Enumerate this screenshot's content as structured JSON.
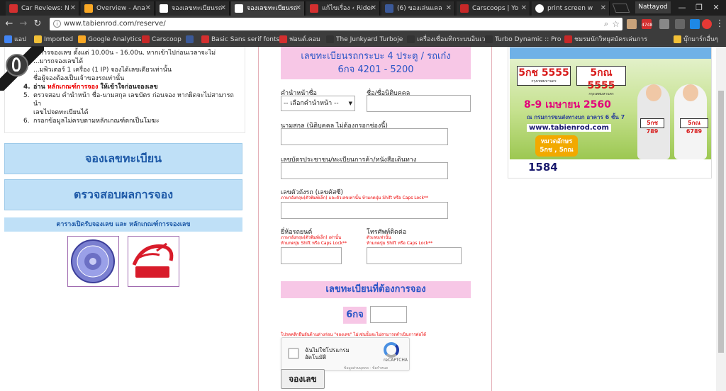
{
  "browser": {
    "tabs": [
      {
        "title": "Car Reviews: N",
        "favicon_color": "#d32f2f"
      },
      {
        "title": "Overview - Ana",
        "favicon_color": "#f9a825"
      },
      {
        "title": "จองเลขทะเบียนรถ",
        "favicon_color": "#ffffff"
      },
      {
        "title": "จองเลขทะเบียนรถ",
        "favicon_color": "#ffffff"
      },
      {
        "title": "แก้ไขเรื่อง ‹ Rider",
        "favicon_color": "#d32f2f"
      },
      {
        "title": "(6) ของเล่นแคล",
        "favicon_color": "#3b5998"
      },
      {
        "title": "Carscoops | Yo",
        "favicon_color": "#c62828"
      },
      {
        "title": "print screen w",
        "favicon_color": "#ffffff"
      }
    ],
    "user_name": "Nattayod",
    "url": "www.tabienrod.com/reserve/",
    "bookmarks": [
      {
        "label": "แอป",
        "color": "#4285f4"
      },
      {
        "label": "Imported",
        "color": "#f2c037"
      },
      {
        "label": "Google Analytics",
        "color": "#f9a825"
      },
      {
        "label": "Carscoop",
        "color": "#c62828"
      },
      {
        "label": "",
        "color": "#3b5998"
      },
      {
        "label": "Basic Sans serif fonts",
        "color": "#d32f2f"
      },
      {
        "label": "ฟอนต์.คอม",
        "color": "#d32f2f"
      },
      {
        "label": "The Junkyard Turboje",
        "color": "#333333"
      },
      {
        "label": "เครื่องเชื่อมทิกระบบอินเวอ",
        "color": "#333333"
      },
      {
        "label": "Turbo Dynamic :: Pro",
        "color": "#333333"
      },
      {
        "label": "ชมรมนักวิทยุสมัครเล่นการ",
        "color": "#c62828"
      },
      {
        "label": "บุ๊กมาร์กอื่นๆ",
        "color": "#f2c037"
      }
    ],
    "ext_badge": "4748"
  },
  "left": {
    "rules": [
      {
        "n": "",
        "text": "...การจองเลข ตั้งแต่ 10.00น - 16.00น. หากเข้าไปก่อนเวลาจะไม่"
      },
      {
        "n": "",
        "text": "...มารถจองเลขได้"
      },
      {
        "n": "",
        "text": "...มพิวเตอร์ 1 เครื่อง (1 IP) จองได้เลขเดียวเท่านั้น"
      },
      {
        "n": "",
        "text": "ชื่อผู้จองต้องเป็นเจ้าของรถเท่านั้น"
      },
      {
        "n": "4.",
        "text": "อ่าน ",
        "red": "หลักเกณฑ์การจอง",
        "after": " ให้เข้าใจก่อนจองเลข"
      },
      {
        "n": "5.",
        "text": "ตรวจสอบ คำนำหน้า ชื่อ-นามสกุล เลขบัตร ก่อนจอง หากผิดจะไม่สามารถนำ"
      },
      {
        "n": "",
        "text": "เลขไปจดทะเบียนได้"
      },
      {
        "n": "6.",
        "text": "กรอกข้อมูลไม่ครบตามหลักเกณฑ์ตกเป็นโมฆะ"
      }
    ],
    "btn_reserve": "จองเลขทะเบียน",
    "btn_check": "ตรวจสอบผลการจอง",
    "link_schedule": "ตารางเปิดรับจองเลข และ หลักเกณฑ์การจองเลข"
  },
  "form": {
    "heading_line1": "เลขทะเบียนรถกระบะ 4 ประตู / รถเก๋ง",
    "heading_line2": "6กจ 4201 - 5200",
    "title_label": "คำนำหน้าชื่อ",
    "title_value": "-- เลือกคำนำหน้า --",
    "name_label": "ชื่อ/ชื่อนิติบุคคล",
    "surname_label": "นามสกุล (นิติบุคคล ไม่ต้องกรอกช่องนี้)",
    "id_label": "เลขบัตรประชาชน/ทะเบียนการค้า/หนังสือเดินทาง",
    "chassis_label": "เลขตัวถังรถ (เลขคัสซี)",
    "chassis_hint": "ภาษาอังกฤษ(ตัวพิมพ์เล็ก) และตัวเลขเท่านั้น ห้ามกดปุ่ม Shift หรือ Caps Lock**",
    "brand_label": "ยี่ห้อรถยนต์",
    "brand_hint1": "ภาษาอังกฤษ(ตัวพิมพ์เล็ก) เท่านั้น",
    "brand_hint2": "ห้ามกดปุ่ม Shift หรือ Caps Lock**",
    "phone_label": "โทรศัพท์ติดต่อ",
    "phone_hint1": "ตัวเลขเท่านั้น",
    "phone_hint2": "ห้ามกดปุ่ม Shift หรือ Caps Lock**",
    "section_heading": "เลขทะเบียนที่ต้องการจอง",
    "plate_prefix": "6กจ",
    "plate_number": "",
    "warning": "โปรดคลิกยืนยันด้านล่างก่อน \"จองเลข\" ไม่เช่นนั้นจะไม่สามารถดำเนินการต่อได้",
    "captcha_text_line1": "ฉันไม่ใช่โปรแกรม",
    "captcha_text_line2": "อัตโนมัติ",
    "captcha_brand": "reCAPTCHA",
    "captcha_privacy": "ข้อมูลส่วนบุคคล - ข้อกำหนด",
    "submit_label": "จองเลข"
  },
  "ad": {
    "plate1": "5กช 5555",
    "plate1_sub": "กรุงเทพมหานคร",
    "plate2": "5กณ 5555",
    "plate2_sub": "กรุงเทพมหานคร",
    "date": "8-9 เมษายน 2560",
    "venue": "ณ กรมการขนส่งทางบก อาคาร 6 ชั้น 7",
    "url": "www.tabienrod.com",
    "badge_line1": "หมวดอักษร",
    "badge_line2": "5กช , 5กณ",
    "hotline": "1584",
    "hand_plate1": "5กช 789",
    "hand_plate2": "5กณ 6789"
  }
}
